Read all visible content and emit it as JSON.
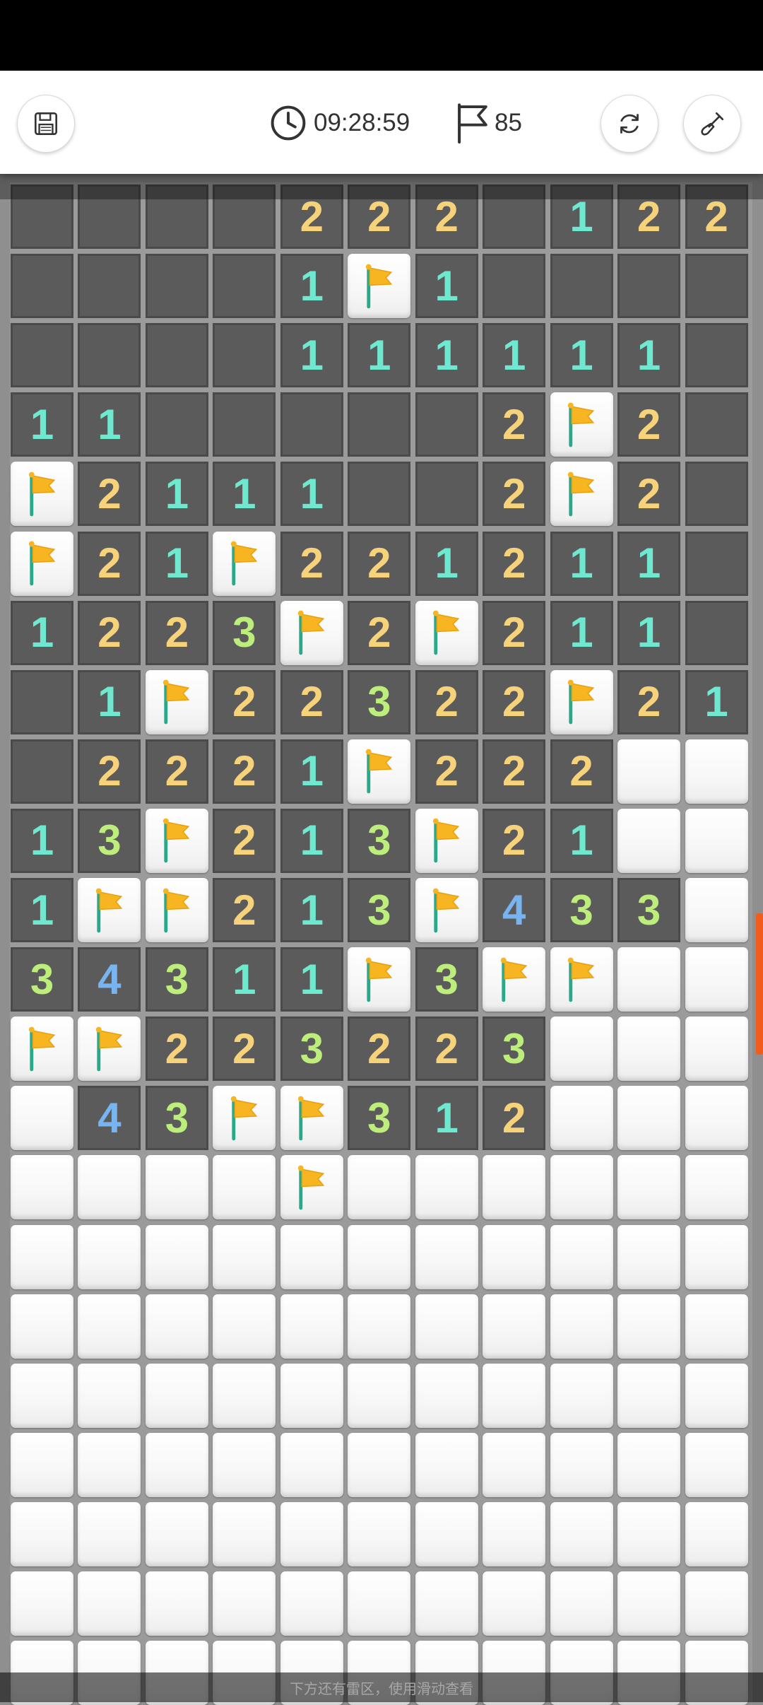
{
  "header": {
    "timer": "09:28:59",
    "flags_remaining": "85",
    "save_button_icon": "floppy-disk-icon",
    "timer_icon": "clock-icon",
    "flag_counter_icon": "flag-outline-icon",
    "restart_button_icon": "refresh-icon",
    "tool_button_icon": "shovel-icon"
  },
  "board": {
    "columns": 11,
    "visible_rows": 22,
    "legend": "rows listed top to bottom; '.' revealed empty, 'F' flagged, 'H' unrevealed, digit = revealed count",
    "rows": [
      "....222.122",
      "....1F1....",
      "....111111.",
      "11.....2F2.",
      "F2111..2F2.",
      "F21F221211.",
      "1223F2F211.",
      ".1F22322F21",
      ".2221F222HH",
      "13F213F21HH",
      "1FF213F433H",
      "34311F3FFHH",
      "FF223223HHH",
      "H43FF312HHH",
      "HHHHFHHHHHH",
      "HHHHHHHHHHH",
      "HHHHHHHHHHH",
      "HHHHHHHHHHH",
      "HHHHHHHHHHH",
      "HHHHHHHHHHH",
      "HHHHHHHHHHH",
      "HHHHHHHHHHH"
    ]
  },
  "number_colors": {
    "1": "#6ee8cf",
    "2": "#f6d27a",
    "3": "#bdee7b",
    "4": "#78b4f0"
  },
  "colors": {
    "flag": "#f7b521",
    "flag_pole": "#2aa88a",
    "scroll_thumb": "#f25c1d"
  },
  "footer_hint": "下方还有雷区，使用滑动查看"
}
